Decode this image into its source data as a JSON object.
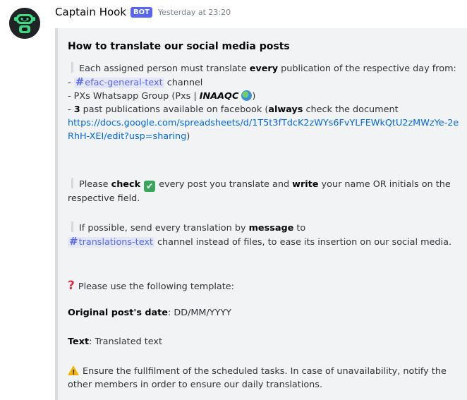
{
  "message": {
    "author": "Captain Hook",
    "bot_tag": "BOT",
    "timestamp": "Yesterday at 23:20",
    "avatar_icon": "robot-icon"
  },
  "embed": {
    "title": "How to translate our social media posts",
    "p1": {
      "pre": "Each assigned person must translate ",
      "bold": "every",
      "post": " publication of the respective day from:"
    },
    "list": {
      "item1_prefix": "- ",
      "item1_channel": "efac-general-text",
      "item1_suffix": " channel",
      "item2_prefix": "- PXs Whatsapp Group (Pxs | ",
      "item2_bold": "INAAQC",
      "item2_suffix": ")",
      "item3_prefix": "- ",
      "item3_bold_num": "3",
      "item3_mid": " past publications available on facebook (",
      "item3_bold": "always",
      "item3_end": " check the document",
      "link": "https://docs.google.com/spreadsheets/d/1T5t3fTdcK2zWYs6FvYLFEWkQtU2zMWzYe-2eRhH-XEI/edit?usp=sharing",
      "link_close": ")"
    },
    "p2": {
      "pre": "Please ",
      "bold1": "check",
      "mid": " every post you translate and ",
      "bold2": "write",
      "post": " your name OR initials on the respective field."
    },
    "p3": {
      "pre": "If possible, send every translation by ",
      "bold": "message",
      "to": " to",
      "channel": "translations-text",
      "post": " channel instead of files, to ease its insertion on our social media."
    },
    "p4": "Please use the following template:",
    "p5": {
      "bold": "Original post's date",
      "rest": ": DD/MM/YYYY"
    },
    "p6": {
      "bold": "Text",
      "rest": ": Translated text"
    },
    "p7": "Ensure the fullfilment of the scheduled tasks. In case of unavailability, notify the other members in order to ensure our daily translations."
  },
  "colors": {
    "accent": "#5865f2",
    "link": "#0068e0",
    "embed_bg": "#f2f3f5",
    "check_green": "#3ba55d",
    "question_red": "#dd2e44",
    "warning_yellow": "#f5b400"
  }
}
